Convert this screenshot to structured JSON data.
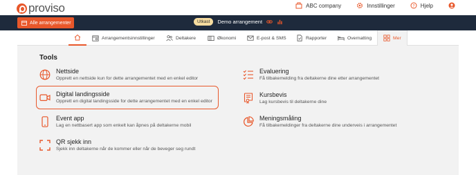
{
  "brand": {
    "name": "proviso"
  },
  "topnav": {
    "company": "ABC company",
    "settings": "Innstillinger",
    "help": "Hjelp"
  },
  "darkbar": {
    "all_events": "Alle arrangementer",
    "status_badge": "Utkast",
    "event_name": "Demo arrangement"
  },
  "tabs": [
    {
      "label": "",
      "icon": "home-icon"
    },
    {
      "label": "Arrangementsinnstillinger",
      "icon": "calendar-settings-icon"
    },
    {
      "label": "Deltakere",
      "icon": "users-icon"
    },
    {
      "label": "Økonomi",
      "icon": "wallet-icon"
    },
    {
      "label": "E-post & SMS",
      "icon": "mail-icon"
    },
    {
      "label": "Rapporter",
      "icon": "report-icon"
    },
    {
      "label": "Overnatting",
      "icon": "bed-icon"
    },
    {
      "label": "Mer",
      "icon": "grid-icon"
    }
  ],
  "tools_title": "Tools",
  "tools": [
    {
      "title": "Nettside",
      "desc": "Opprett en nettside kun for dette arrangementet med en enkel editor",
      "icon": "globe-icon"
    },
    {
      "title": "Digital landingsside",
      "desc": "Opprett en digital landingsside for dette arrangementet med en enkel editor",
      "icon": "video-icon"
    },
    {
      "title": "Event app",
      "desc": "Lag en nettbasert app som enkelt kan åpnes på deltakerne mobil",
      "icon": "mobile-icon"
    },
    {
      "title": "QR sjekk inn",
      "desc": "Sjekk inn deltakerne når de kommer eller når de beveger seg rundt",
      "icon": "qr-scan-icon"
    },
    {
      "title": "Evaluering",
      "desc": "Få tilbakemelding fra deltakerne dine etter arrangementet",
      "icon": "checklist-icon"
    },
    {
      "title": "Kursbevis",
      "desc": "Lag kursbevis til deltakerne dine",
      "icon": "certificate-icon"
    },
    {
      "title": "Meningsmåling",
      "desc": "Få tilbakemeldinger fra deltakerne dine underveis i arrangementet",
      "icon": "pie-chart-icon"
    }
  ],
  "colors": {
    "accent": "#e8572a",
    "dark": "#1e2a3c",
    "panel": "#f2f2f2"
  }
}
